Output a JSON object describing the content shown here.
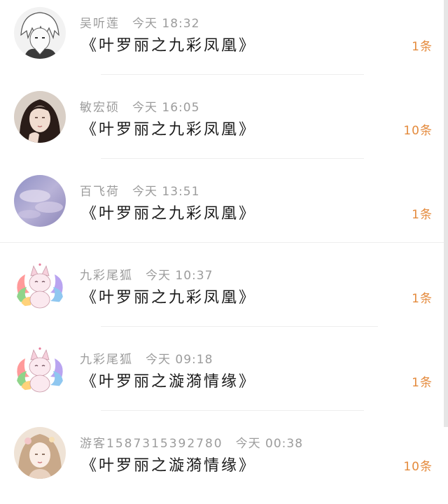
{
  "messages": [
    {
      "sender": "吴听莲",
      "time": "今天 18:32",
      "title": "《叶罗丽之九彩凤凰》",
      "count": "1条",
      "avatar_icon": "anime-boy-avatar-icon"
    },
    {
      "sender": "敏宏硕",
      "time": "今天 16:05",
      "title": "《叶罗丽之九彩凤凰》",
      "count": "10条",
      "avatar_icon": "girl-photo-avatar-icon"
    },
    {
      "sender": "百飞荷",
      "time": "今天 13:51",
      "title": "《叶罗丽之九彩凤凰》",
      "count": "1条",
      "avatar_icon": "sky-avatar-icon"
    },
    {
      "sender": "九彩尾狐",
      "time": "今天 10:37",
      "title": "《叶罗丽之九彩凤凰》",
      "count": "1条",
      "avatar_icon": "fox-avatar-icon"
    },
    {
      "sender": "九彩尾狐",
      "time": "今天 09:18",
      "title": "《叶罗丽之漩漪情缘》",
      "count": "1条",
      "avatar_icon": "fox-avatar-icon"
    },
    {
      "sender": "游客1587315392780",
      "time": "今天 00:38",
      "title": "《叶罗丽之漩漪情缘》",
      "count": "10条",
      "avatar_icon": "anime-girl-avatar-icon"
    }
  ],
  "colors": {
    "meta_text": "#9c9c9c",
    "title_text": "#1a1a1a",
    "count_text": "#e48a3c",
    "divider": "#eeeeee"
  }
}
